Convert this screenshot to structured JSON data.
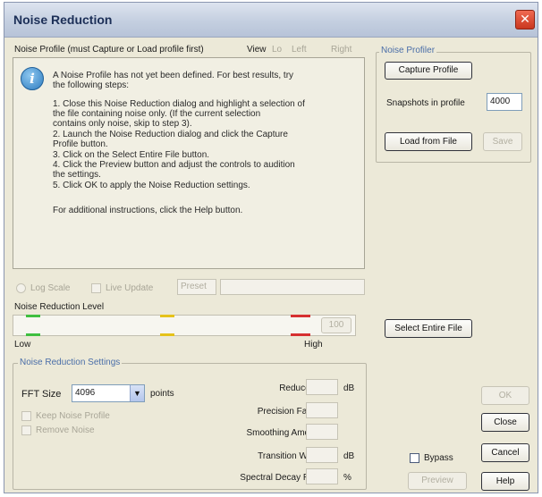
{
  "window": {
    "title": "Noise Reduction",
    "close_glyph": "✕"
  },
  "profile_header": {
    "label": "Noise Profile (must Capture or Load profile first)",
    "view_label": "View",
    "view_opt1": "Lo",
    "view_opt2": "Left",
    "view_opt3": "Right"
  },
  "info": {
    "icon": "info-icon",
    "intro_lines": [
      "A Noise Profile has not yet been defined.  For best results, try",
      "the following steps:"
    ],
    "steps": [
      "1. Close this Noise Reduction dialog and highlight a selection of",
      "    the file containing noise only.  (If the current selection",
      "    contains only noise, skip to step 3).",
      "2. Launch the Noise Reduction dialog and click the Capture",
      "    Profile button.",
      "3. Click on the Select Entire File button.",
      "4. Click the Preview button and adjust the controls to audition",
      "    the settings.",
      "5. Click OK to apply the Noise Reduction settings."
    ],
    "footer": "For additional instructions, click the Help button."
  },
  "noise_profiler": {
    "label": "Noise Profiler",
    "capture_label": "Capture Profile",
    "snapshots_label": "Snapshots in profile",
    "snapshots_value": "4000",
    "load_label": "Load from File",
    "save_label": "Save"
  },
  "row_below_profile": {
    "log_scale": "Log Scale",
    "live_update": "Live Update",
    "preset": "Preset"
  },
  "level": {
    "label": "Noise Reduction Level",
    "low": "Low",
    "high": "High",
    "value_button": "100"
  },
  "select_entire": "Select Entire File",
  "settings": {
    "label": "Noise Reduction Settings",
    "fft_label": "FFT Size",
    "fft_value": "4096",
    "fft_units": "points",
    "opt_keep": "Keep Noise Profile",
    "opt_remove": "Remove Noise",
    "reduce_by": "Reduce by",
    "reduce_unit": "dB",
    "precision": "Precision Factor",
    "smoothing": "Smoothing Amount",
    "transition": "Transition Width",
    "transition_unit": "dB",
    "spectral": "Spectral Decay Rate",
    "spectral_unit": "%"
  },
  "bypass_label": "Bypass",
  "buttons": {
    "ok": "OK",
    "close": "Close",
    "cancel": "Cancel",
    "help": "Help",
    "preview": "Preview"
  },
  "colors": {
    "slider_green": "#3fbf3f",
    "slider_yellow": "#e5c21a",
    "slider_red": "#d63030",
    "title_text": "#1c2f57",
    "group_label": "#4a6ea8"
  }
}
